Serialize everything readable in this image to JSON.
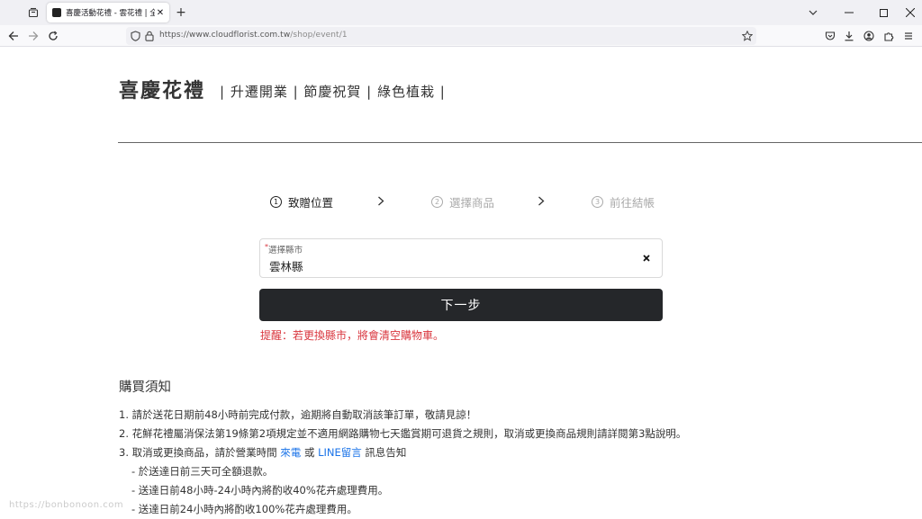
{
  "browser": {
    "tab_title": "喜慶活動花禮 - 雲花禮 | 全台花",
    "tab_close": "✕",
    "new_tab": "+",
    "url_host": "https://www.cloudflorist.com.tw",
    "url_path": "/shop/event/1"
  },
  "header": {
    "brand": "喜慶花禮",
    "subtitle": "| 升遷開業 | 節慶祝賀 | 綠色植栽 |"
  },
  "steps": [
    {
      "num": "1",
      "label": "致贈位置",
      "state": "active"
    },
    {
      "num": "2",
      "label": "選擇商品",
      "state": "inactive"
    },
    {
      "num": "3",
      "label": "前往結帳",
      "state": "inactive"
    }
  ],
  "city_select": {
    "required_mark": "*",
    "label": "選擇縣市",
    "value": "雲林縣"
  },
  "next_button": "下一步",
  "warning": "提醒：若更換縣市，將會清空購物車。",
  "notice": {
    "title": "購買須知",
    "item1": "1. 請於送花日期前48小時前完成付款，逾期將自動取消該筆訂單，敬請見諒！",
    "item2": "2. 花鮮花禮屬消保法第19條第2項規定並不適用網路購物七天鑑賞期可退貨之規則，取消或更換商品規則請詳閱第3點說明。",
    "item3_prefix": "3. 取消或更換商品，請於營業時間 ",
    "item3_link1": "來電",
    "item3_mid": " 或 ",
    "item3_link2": "LINE留言",
    "item3_suffix": " 訊息告知",
    "sub1": "- 於送達日前三天可全額退款。",
    "sub2": "- 送達日前48小時-24小時內將酌收40%花卉處理費用。",
    "sub3": "- 送達日前24小時內將酌收100%花卉處理費用。"
  },
  "watermark": "https://bonbonoon.com",
  "colors": {
    "accent_dark": "#25272a",
    "warning_red": "#d9363e",
    "link_blue": "#1a73e8"
  }
}
